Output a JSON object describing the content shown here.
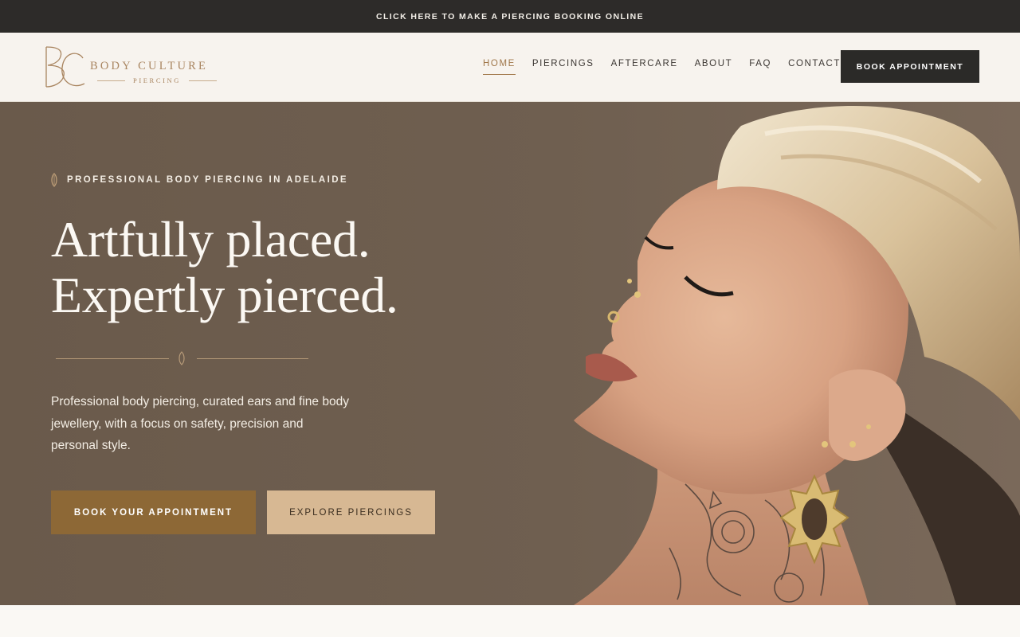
{
  "announcement": {
    "link_label": "CLICK HERE",
    "text": " TO MAKE A PIERCING BOOKING ONLINE"
  },
  "header": {
    "logo": {
      "monogram": "BC",
      "name": "BODY CULTURE",
      "subtitle": "PIERCING"
    },
    "nav": [
      {
        "label": "HOME",
        "active": true
      },
      {
        "label": "PIERCINGS",
        "active": false
      },
      {
        "label": "AFTERCARE",
        "active": false
      },
      {
        "label": "ABOUT",
        "active": false
      },
      {
        "label": "FAQ",
        "active": false
      },
      {
        "label": "CONTACT",
        "active": false
      }
    ],
    "cta_label": "BOOK APPOINTMENT"
  },
  "hero": {
    "eyebrow": "PROFESSIONAL BODY PIERCING IN ADELAIDE",
    "headline_line1": "Artfully placed.",
    "headline_line2": "Expertly pierced.",
    "description": "Professional body piercing, curated ears and fine body jewellery, with a focus on safety, precision and personal style.",
    "primary_cta": "BOOK YOUR APPOINTMENT",
    "secondary_cta": "EXPLORE PIERCINGS"
  },
  "colors": {
    "topbar_bg": "#2d2b29",
    "header_bg": "#f7f3ee",
    "brand_gold": "#a98560",
    "hero_bg": "#6b5b4c",
    "primary_button": "#8d6836",
    "secondary_button": "#d7b893",
    "dark_button": "#2b2a28"
  },
  "icons": {
    "eyebrow": "leaf-icon",
    "divider": "diamond-ornament-icon"
  }
}
